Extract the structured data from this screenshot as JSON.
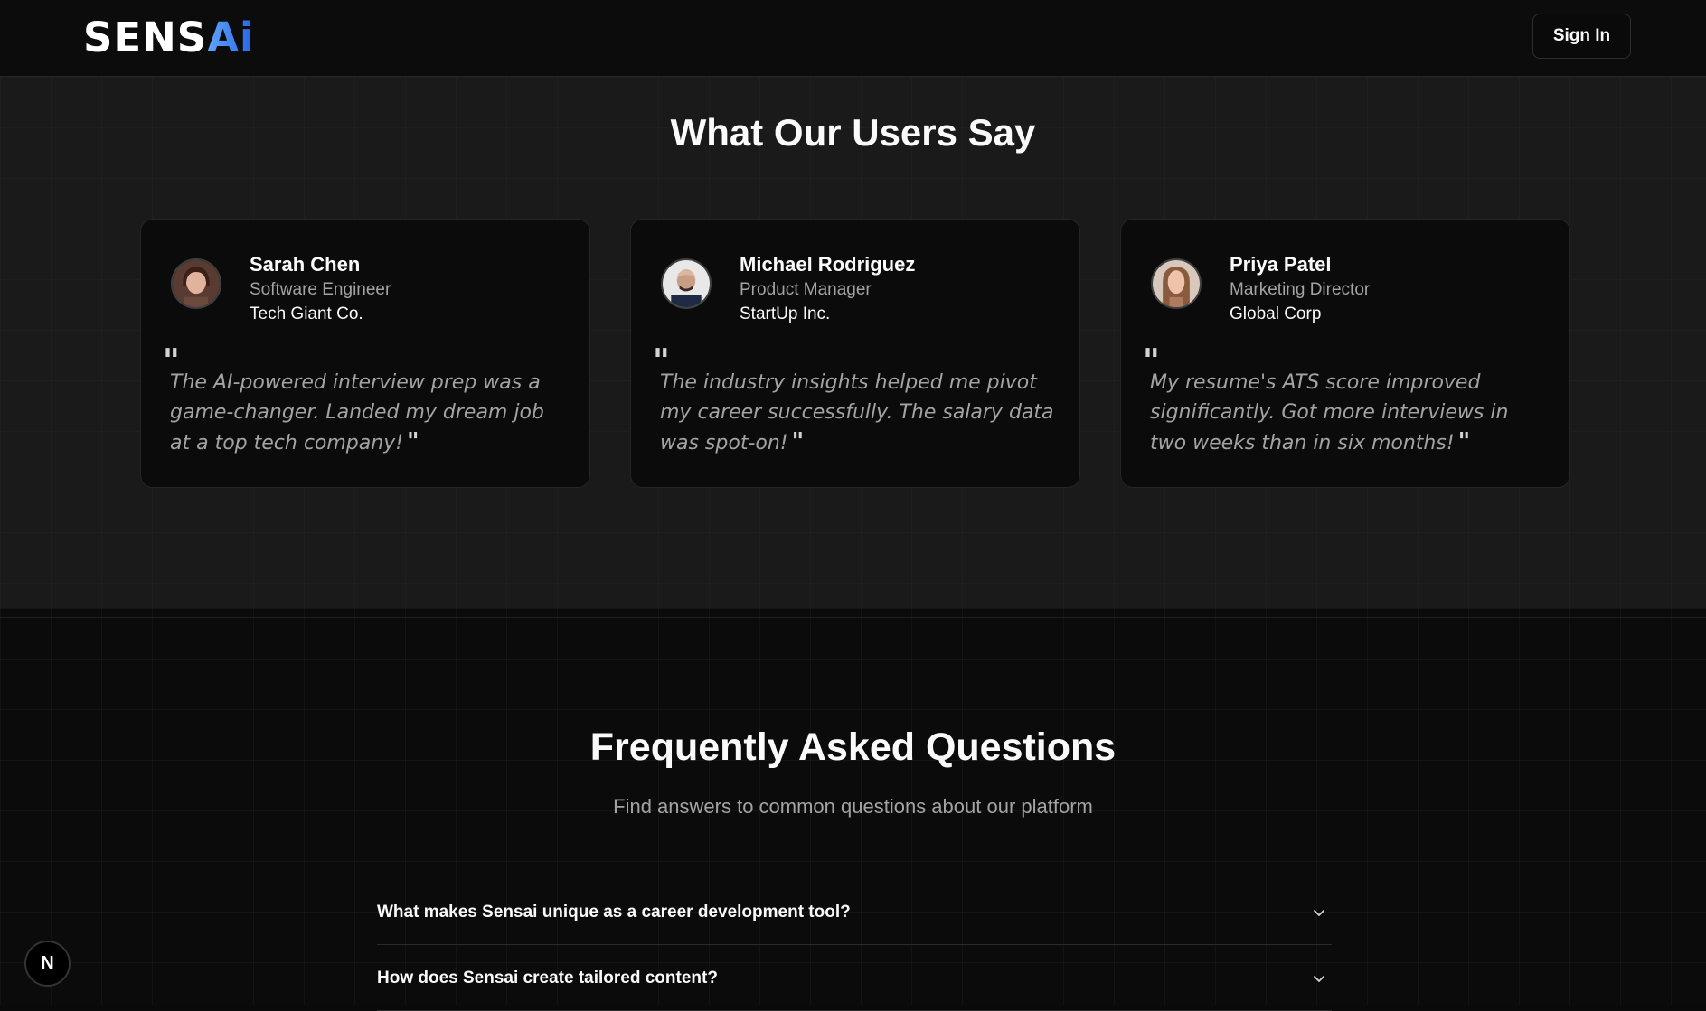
{
  "header": {
    "logo_text": "SENS",
    "logo_accent": "Ai",
    "signin_label": "Sign In"
  },
  "testimonials": {
    "title": "What Our Users Say",
    "items": [
      {
        "name": "Sarah Chen",
        "role": "Software Engineer",
        "company": "Tech Giant Co.",
        "quote": "The AI-powered interview prep was a game-changer. Landed my dream job at a top tech company!"
      },
      {
        "name": "Michael Rodriguez",
        "role": "Product Manager",
        "company": "StartUp Inc.",
        "quote": "The industry insights helped me pivot my career successfully. The salary data was spot-on!"
      },
      {
        "name": "Priya Patel",
        "role": "Marketing Director",
        "company": "Global Corp",
        "quote": "My resume's ATS score improved significantly. Got more interviews in two weeks than in six months!"
      }
    ]
  },
  "faq": {
    "title": "Frequently Asked Questions",
    "subtitle": "Find answers to common questions about our platform",
    "items": [
      {
        "question": "What makes Sensai unique as a career development tool?"
      },
      {
        "question": "How does Sensai create tailored content?"
      }
    ]
  },
  "dev_badge": {
    "label": "N"
  },
  "colors": {
    "background": "#0a0a0a",
    "testimonial_bg": "#1a1a1a",
    "card_bg": "#0b0b0b",
    "muted_text": "#a3a3a3",
    "accent": "#3b82f6"
  }
}
